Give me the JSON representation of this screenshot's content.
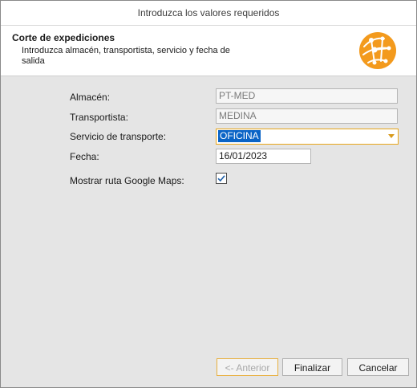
{
  "window": {
    "title": "Introduzca los valores requeridos"
  },
  "header": {
    "title": "Corte de expediciones",
    "subtitle": "Introduzca almacén, transportista, servicio y fecha de salida",
    "logo_icon": "orange-network-globe-logo",
    "accent": "#f39a1d"
  },
  "form": {
    "almacen": {
      "label": "Almacén:",
      "value": "PT-MED"
    },
    "transportista": {
      "label": "Transportista:",
      "value": "MEDINA"
    },
    "servicio": {
      "label": "Servicio de transporte:",
      "value": "OFICINA"
    },
    "fecha": {
      "label": "Fecha:",
      "value": "16/01/2023"
    },
    "google_maps": {
      "label": "Mostrar ruta Google Maps:",
      "checked": true
    }
  },
  "buttons": {
    "back": "<- Anterior",
    "finish": "Finalizar",
    "cancel": "Cancelar"
  },
  "colors": {
    "background": "#e5e5e5",
    "selection": "#0a64c6",
    "focus_border": "#e8a61b"
  }
}
